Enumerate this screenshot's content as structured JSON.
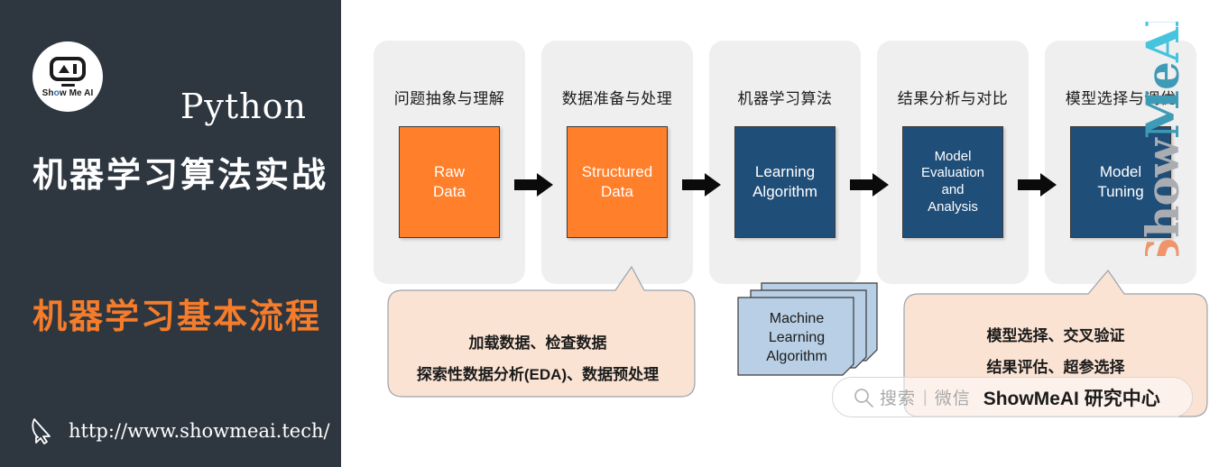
{
  "sidebar": {
    "logo": {
      "face_text": "AI",
      "caption_pre": "Sh",
      "caption_eye": "o",
      "caption_post": "w Me AI",
      "full_caption": "Show Me AI"
    },
    "python_label": "Python",
    "course_title": "机器学习算法实战",
    "topic_title": "机器学习基本流程",
    "url": "http://www.showmeai.tech/",
    "colors": {
      "background": "#2e3640",
      "accent_orange": "#f57c2a",
      "text": "#ffffff"
    }
  },
  "diagram": {
    "stages": [
      {
        "title": "问题抽象与理解",
        "box_lines": [
          "Raw",
          "Data"
        ],
        "box_color": "#ff7f2a",
        "box_style": "orange"
      },
      {
        "title": "数据准备与处理",
        "box_lines": [
          "Structured",
          "Data"
        ],
        "box_color": "#ff7f2a",
        "box_style": "orange"
      },
      {
        "title": "机器学习算法",
        "box_lines": [
          "Learning",
          "Algorithm"
        ],
        "box_color": "#1f4e79",
        "box_style": "navy"
      },
      {
        "title": "结果分析与对比",
        "box_lines": [
          "Model",
          "Evaluation",
          "and",
          "Analysis"
        ],
        "box_color": "#1f4e79",
        "box_style": "navy"
      },
      {
        "title": "模型选择与调优",
        "box_lines": [
          "Model",
          "Tuning"
        ],
        "box_color": "#1f4e79",
        "box_style": "navy"
      }
    ],
    "arrow_count": 4,
    "callout_left": {
      "line1": "加载数据、检查数据",
      "line2": "探索性数据分析(EDA)、数据预处理",
      "color": "#fbe3d3"
    },
    "callout_right": {
      "line1": "模型选择、交叉验证",
      "line2": "结果评估、超参选择",
      "color": "#fbe3d3"
    },
    "stack_card": {
      "lines": [
        "Machine",
        "Learning",
        "Algorithm"
      ],
      "color": "#b8cfe5",
      "card_count": 3
    },
    "panel_color": "#efefef"
  },
  "watermarks": {
    "search_box": {
      "icon": "search-icon",
      "label": "搜索",
      "separator": "|",
      "channel": "微信",
      "brand": "ShowMeAI 研究中心"
    },
    "vertical_brand": {
      "part1": "S",
      "part2": "how",
      "part3": "Me",
      "part4": "AI",
      "full": "ShowMeAI"
    }
  }
}
